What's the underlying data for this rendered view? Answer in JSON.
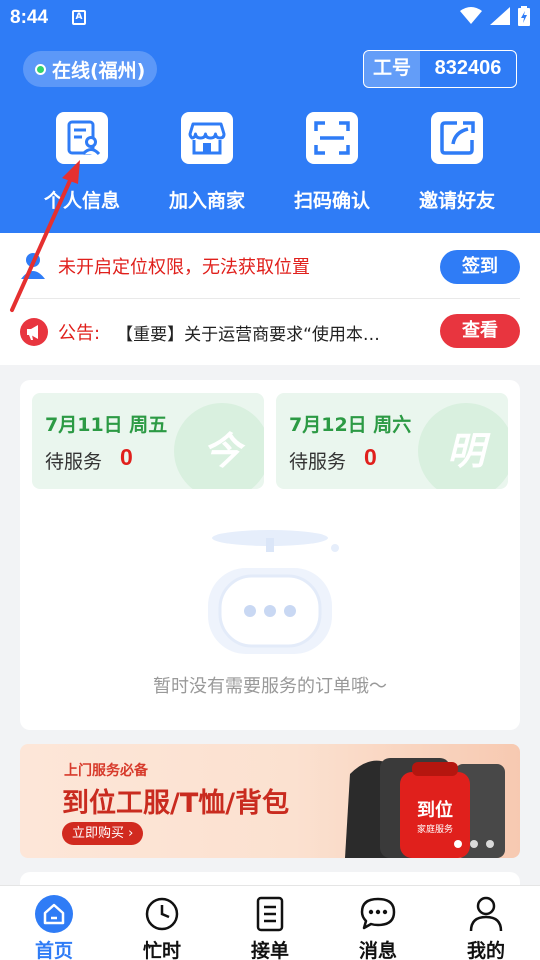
{
  "status_bar": {
    "time": "8:44",
    "app_badge": "A"
  },
  "header": {
    "online_status": "在线(福州)",
    "work_id_label": "工号",
    "work_id_value": "832406",
    "quick_actions": [
      {
        "label": "个人信息",
        "icon": "profile-card-icon"
      },
      {
        "label": "加入商家",
        "icon": "storefront-icon"
      },
      {
        "label": "扫码确认",
        "icon": "scan-icon"
      },
      {
        "label": "邀请好友",
        "icon": "share-icon"
      }
    ]
  },
  "notices": {
    "location_warning": "未开启定位权限，无法获取位置",
    "sign_in_button": "签到",
    "announcement_label": "公告:",
    "announcement_text": "【重要】关于运营商要求“使用本…",
    "view_button": "查看"
  },
  "schedule": {
    "days": [
      {
        "date": "7月11日 周五",
        "label": "待服务",
        "count": "0",
        "watermark": "今"
      },
      {
        "date": "7月12日 周六",
        "label": "待服务",
        "count": "0",
        "watermark": "明"
      }
    ],
    "empty_message": "暂时没有需要服务的订单哦～"
  },
  "banner": {
    "small_title": "上门服务必备",
    "headline": "到位工服/T恤/背包",
    "button": "立即购买 ›",
    "bag_text": "到位",
    "bag_subtext": "家庭服务"
  },
  "tabbar": {
    "items": [
      {
        "label": "首页",
        "icon": "home-icon",
        "active": true
      },
      {
        "label": "忙时",
        "icon": "clock-icon",
        "active": false
      },
      {
        "label": "接单",
        "icon": "order-list-icon",
        "active": false
      },
      {
        "label": "消息",
        "icon": "chat-icon",
        "active": false
      },
      {
        "label": "我的",
        "icon": "user-icon",
        "active": false
      }
    ]
  },
  "colors": {
    "primary": "#2f7cf6",
    "danger": "#e0201c",
    "success": "#2c9a44"
  }
}
